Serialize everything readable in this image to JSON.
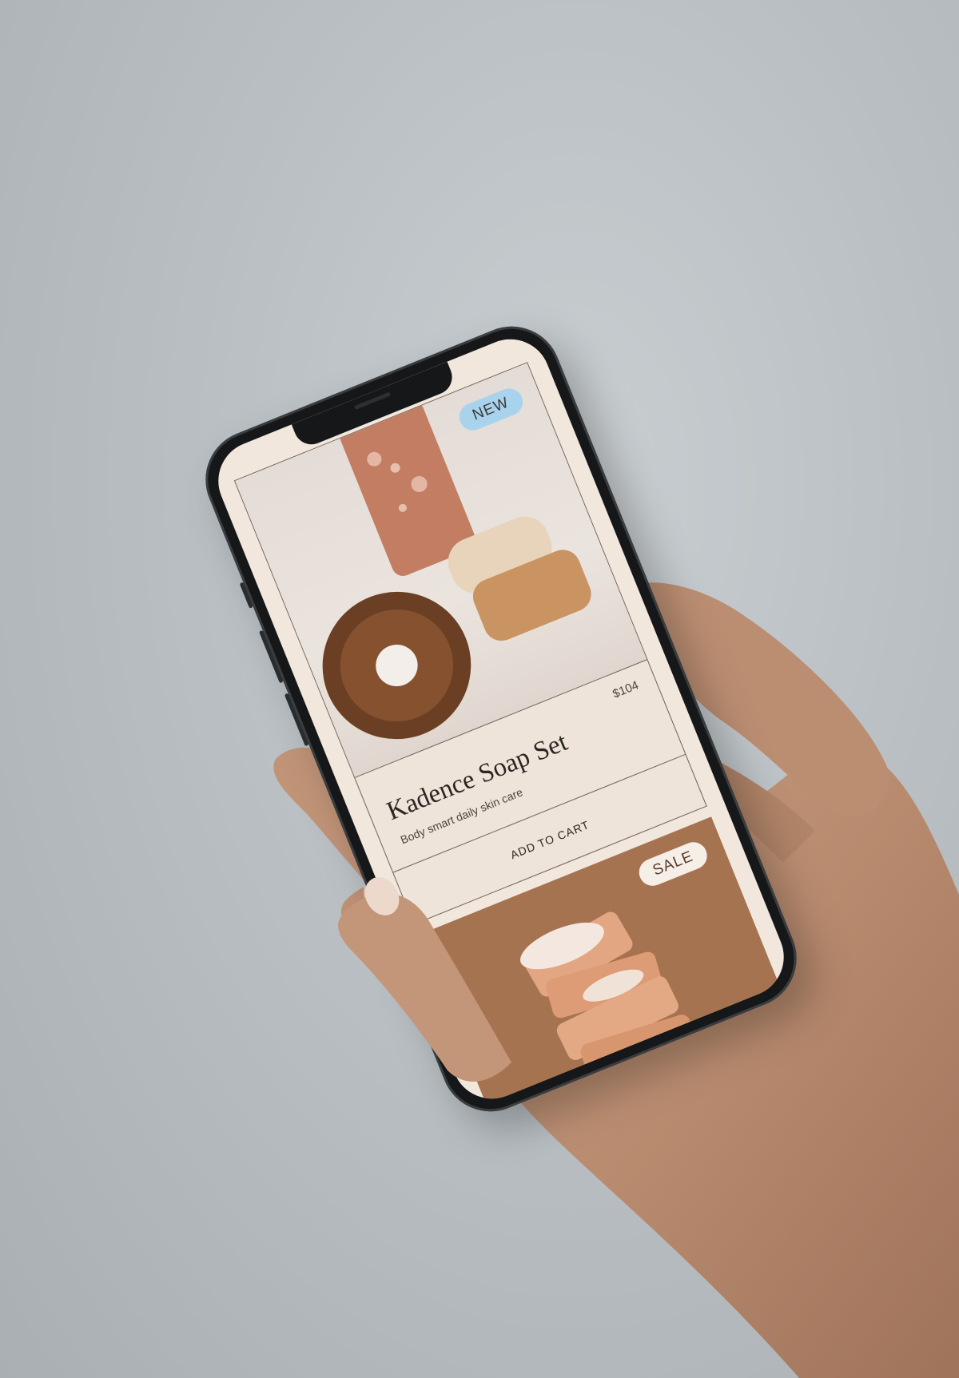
{
  "product_card": {
    "badge": "NEW",
    "title": "Kadence Soap Set",
    "subtitle": "Body smart daily skin care",
    "price": "$104",
    "cta_label": "ADD TO CART"
  },
  "second_card": {
    "badge": "SALE"
  },
  "colors": {
    "screen_bg": "#f1e7dd",
    "new_badge": "#a9d3ec",
    "sale_card_bg": "#a67350",
    "border": "#6f6258"
  }
}
